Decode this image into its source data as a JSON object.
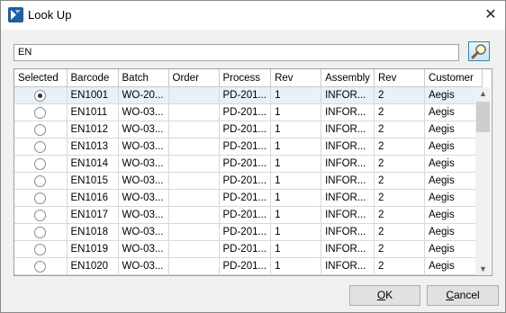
{
  "window": {
    "title": "Look Up",
    "close_symbol": "✕"
  },
  "search": {
    "value": "EN"
  },
  "table": {
    "columns": [
      "Selected",
      "Barcode",
      "Batch",
      "Order",
      "Process",
      "Rev",
      "Assembly",
      "Rev",
      "Customer"
    ],
    "rows": [
      {
        "selected": true,
        "barcode": "EN1001",
        "batch": "WO-20...",
        "order": "",
        "process": "PD-201...",
        "rev": "1",
        "assembly": "INFOR...",
        "rev2": "2",
        "customer": "Aegis"
      },
      {
        "selected": false,
        "barcode": "EN1011",
        "batch": "WO-03...",
        "order": "",
        "process": "PD-201...",
        "rev": "1",
        "assembly": "INFOR...",
        "rev2": "2",
        "customer": "Aegis"
      },
      {
        "selected": false,
        "barcode": "EN1012",
        "batch": "WO-03...",
        "order": "",
        "process": "PD-201...",
        "rev": "1",
        "assembly": "INFOR...",
        "rev2": "2",
        "customer": "Aegis"
      },
      {
        "selected": false,
        "barcode": "EN1013",
        "batch": "WO-03...",
        "order": "",
        "process": "PD-201...",
        "rev": "1",
        "assembly": "INFOR...",
        "rev2": "2",
        "customer": "Aegis"
      },
      {
        "selected": false,
        "barcode": "EN1014",
        "batch": "WO-03...",
        "order": "",
        "process": "PD-201...",
        "rev": "1",
        "assembly": "INFOR...",
        "rev2": "2",
        "customer": "Aegis"
      },
      {
        "selected": false,
        "barcode": "EN1015",
        "batch": "WO-03...",
        "order": "",
        "process": "PD-201...",
        "rev": "1",
        "assembly": "INFOR...",
        "rev2": "2",
        "customer": "Aegis"
      },
      {
        "selected": false,
        "barcode": "EN1016",
        "batch": "WO-03...",
        "order": "",
        "process": "PD-201...",
        "rev": "1",
        "assembly": "INFOR...",
        "rev2": "2",
        "customer": "Aegis"
      },
      {
        "selected": false,
        "barcode": "EN1017",
        "batch": "WO-03...",
        "order": "",
        "process": "PD-201...",
        "rev": "1",
        "assembly": "INFOR...",
        "rev2": "2",
        "customer": "Aegis"
      },
      {
        "selected": false,
        "barcode": "EN1018",
        "batch": "WO-03...",
        "order": "",
        "process": "PD-201...",
        "rev": "1",
        "assembly": "INFOR...",
        "rev2": "2",
        "customer": "Aegis"
      },
      {
        "selected": false,
        "barcode": "EN1019",
        "batch": "WO-03...",
        "order": "",
        "process": "PD-201...",
        "rev": "1",
        "assembly": "INFOR...",
        "rev2": "2",
        "customer": "Aegis"
      },
      {
        "selected": false,
        "barcode": "EN1020",
        "batch": "WO-03...",
        "order": "",
        "process": "PD-201...",
        "rev": "1",
        "assembly": "INFOR...",
        "rev2": "2",
        "customer": "Aegis"
      }
    ]
  },
  "buttons": {
    "ok": {
      "mnemonic": "O",
      "rest": "K"
    },
    "cancel": {
      "mnemonic": "C",
      "rest": "ancel"
    }
  },
  "colors": {
    "selected_row": "#e8f0fa",
    "accent": "#3c7fb1"
  }
}
